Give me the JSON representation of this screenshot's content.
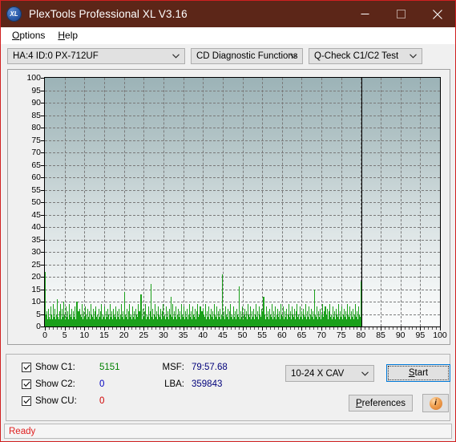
{
  "window": {
    "title": "PlexTools Professional XL V3.16",
    "logo_text": "XL",
    "minimize_label": "minimize",
    "maximize_label": "maximize",
    "close_label": "close"
  },
  "menu": {
    "items": [
      {
        "label": "Options",
        "accel": "O"
      },
      {
        "label": "Help",
        "accel": "H"
      }
    ]
  },
  "toolbar": {
    "drive_combo": "HA:4 ID:0  PX-712UF",
    "function_combo": "CD Diagnostic Functions",
    "test_combo": "Q-Check C1/C2 Test"
  },
  "chart_data": {
    "type": "bar",
    "title": "",
    "xlabel": "",
    "ylabel": "",
    "xlim": [
      0,
      100
    ],
    "ylim": [
      0,
      100
    ],
    "x_ticks": [
      0,
      5,
      10,
      15,
      20,
      25,
      30,
      35,
      40,
      45,
      50,
      55,
      60,
      65,
      70,
      75,
      80,
      85,
      90,
      95,
      100
    ],
    "y_ticks": [
      0,
      5,
      10,
      15,
      20,
      25,
      30,
      35,
      40,
      45,
      50,
      55,
      60,
      65,
      70,
      75,
      80,
      85,
      90,
      95,
      100
    ],
    "grid": true,
    "legend": "none",
    "series": [
      {
        "name": "C1",
        "color": "#1ba01b",
        "data_end_x": 80.1,
        "values": [
          22,
          5,
          6,
          3,
          7,
          4,
          3,
          8,
          5,
          3,
          9,
          4,
          7,
          3,
          5,
          11,
          4,
          3,
          6,
          9,
          3,
          7,
          4,
          10,
          5,
          3,
          8,
          4,
          6,
          3,
          9,
          5,
          4,
          7,
          3,
          6,
          4,
          8,
          3,
          5,
          10,
          4,
          6,
          3,
          7,
          5,
          4,
          9,
          3,
          6,
          4,
          8,
          5,
          3,
          7,
          4,
          6,
          3,
          9,
          5,
          4,
          7,
          3,
          6,
          8,
          4,
          5,
          3,
          7,
          4,
          6,
          9,
          3,
          5,
          4,
          8,
          3,
          6,
          4,
          7,
          5,
          3,
          9,
          4,
          6,
          3,
          7,
          5,
          4,
          8,
          3,
          6,
          4,
          7,
          3,
          5,
          9,
          4,
          6,
          3,
          14,
          5,
          4,
          7,
          3,
          6,
          9,
          4,
          5,
          3,
          8,
          4,
          6,
          3,
          7,
          5,
          4,
          9,
          3,
          6,
          4,
          13,
          5,
          3,
          7,
          4,
          6,
          9,
          3,
          5,
          4,
          8,
          3,
          6,
          17,
          4,
          7,
          3,
          5,
          9,
          4,
          6,
          3,
          8,
          5,
          4,
          7,
          3,
          6,
          9,
          4,
          5,
          3,
          8,
          4,
          6,
          3,
          7,
          5,
          12,
          4,
          9,
          3,
          6,
          4,
          8,
          3,
          5,
          7,
          4,
          6,
          3,
          9,
          5,
          4,
          8,
          3,
          6,
          4,
          7,
          3,
          5,
          9,
          4,
          6,
          3,
          8,
          5,
          4,
          7,
          3,
          6,
          9,
          4,
          5,
          3,
          8,
          4,
          6,
          3,
          7,
          5,
          4,
          9,
          3,
          6,
          4,
          8,
          3,
          5,
          7,
          4,
          6,
          3,
          9,
          5,
          4,
          8,
          3,
          6,
          4,
          7,
          3,
          5,
          21,
          4,
          6,
          3,
          8,
          5,
          4,
          7,
          3,
          6,
          9,
          4,
          5,
          3,
          8,
          4,
          6,
          3,
          7,
          5,
          4,
          16,
          3,
          6,
          4,
          8,
          3,
          5,
          7,
          4,
          6,
          3,
          9,
          5,
          4,
          8,
          3,
          6,
          4,
          7,
          3,
          5,
          9,
          4,
          6,
          3,
          8,
          5,
          4,
          7,
          3,
          6,
          12,
          4,
          5,
          3,
          8,
          4,
          6,
          3,
          7,
          5,
          4,
          9,
          3,
          6,
          4,
          8,
          3,
          5,
          7,
          4,
          6,
          3,
          9,
          5,
          4,
          8,
          3,
          6,
          4,
          7,
          3,
          5,
          9,
          4,
          6,
          3,
          8,
          5,
          4,
          7,
          3,
          6,
          9,
          4,
          5,
          3,
          8,
          4,
          6,
          3,
          7,
          5,
          4,
          9,
          3,
          6,
          4,
          8,
          3,
          5,
          7,
          4,
          6,
          3,
          15,
          5,
          4,
          8,
          3,
          6,
          4,
          7,
          3,
          5,
          9,
          4,
          6,
          3,
          8,
          5,
          4,
          7,
          3,
          6,
          9,
          4,
          5,
          3,
          8,
          4,
          6,
          3,
          7,
          5,
          4,
          9,
          3,
          6,
          4,
          8,
          3,
          5,
          7,
          4,
          6,
          3,
          9,
          5,
          4,
          8,
          3,
          6,
          4,
          7,
          3,
          5,
          9,
          4,
          6,
          3,
          8,
          5,
          4,
          18
        ]
      }
    ]
  },
  "results": {
    "checkboxes": [
      {
        "label": "Show C1:",
        "value": "5151",
        "color": "#008000",
        "checked": true
      },
      {
        "label": "Show C2:",
        "value": "0",
        "color": "#0000c0",
        "checked": true
      },
      {
        "label": "Show CU:",
        "value": "0",
        "color": "#d00000",
        "checked": true
      }
    ],
    "msf_label": "MSF:",
    "msf_value": "79:57.68",
    "lba_label": "LBA:",
    "lba_value": "359843",
    "speed_combo": "10-24 X CAV",
    "start_button": "Start",
    "start_accel": "S",
    "preferences_button": "Preferences",
    "preferences_accel": "P",
    "info_button": "i"
  },
  "status": {
    "text": "Ready",
    "color": "#e02020"
  }
}
